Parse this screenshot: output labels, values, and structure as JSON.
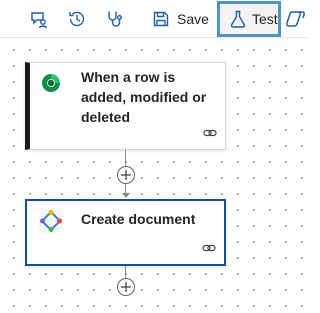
{
  "toolbar": {
    "save_label": "Save",
    "test_label": "Test"
  },
  "flow": {
    "trigger_title": "When a row is added, modified or deleted",
    "action_title": "Create document"
  },
  "icons": {
    "chat": "chat-person-icon",
    "history": "history-icon",
    "checker": "stethoscope-icon",
    "save": "save-icon",
    "test": "flask-icon",
    "copilot": "copilot-icon",
    "dataverse": "dataverse-icon",
    "document_app": "document-generation-icon",
    "link": "link-icon",
    "add": "add-step-icon"
  },
  "colors": {
    "accent_blue": "#1f5fa8",
    "selected_border": "#1a4d96",
    "highlight_border": "#4a97c6",
    "dataverse_green": "#0b8f4a"
  }
}
